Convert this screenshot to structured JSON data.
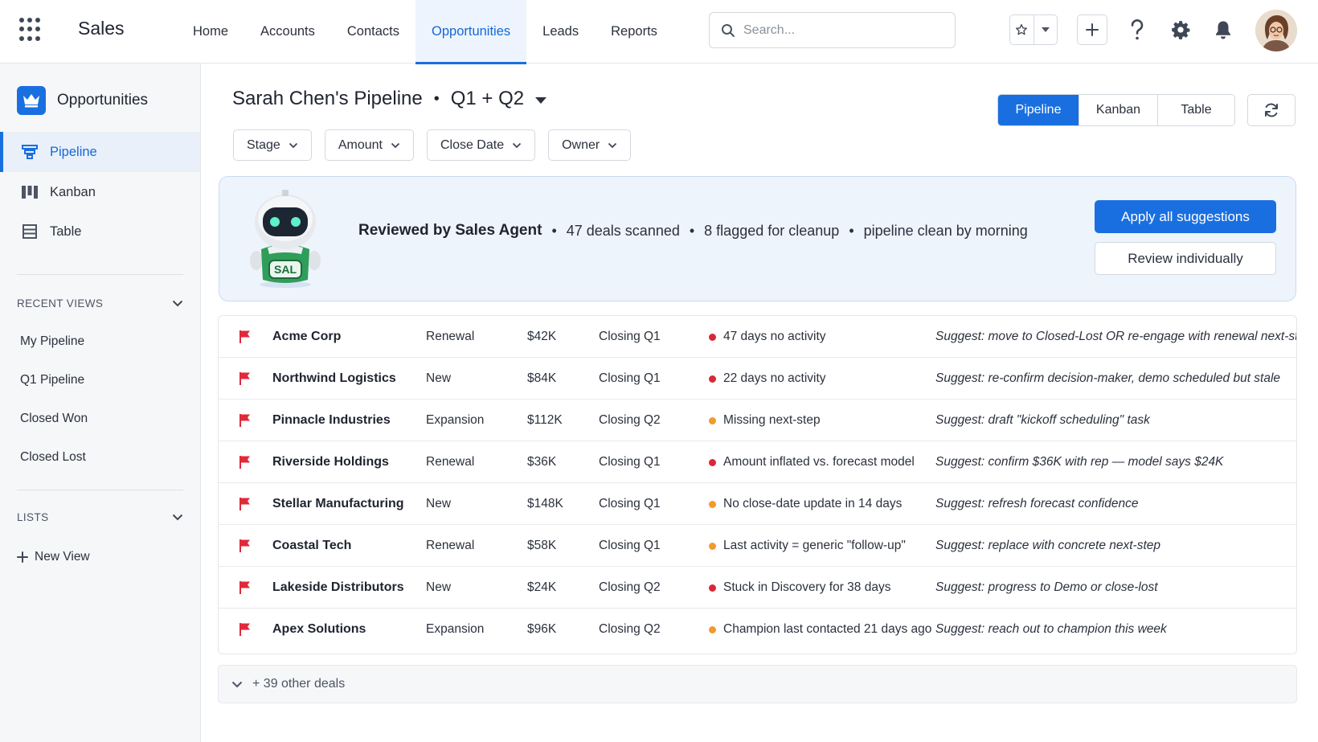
{
  "app": {
    "name": "Sales"
  },
  "nav": {
    "items": [
      "Home",
      "Accounts",
      "Contacts",
      "Opportunities",
      "Leads",
      "Reports"
    ],
    "active": "Opportunities"
  },
  "search": {
    "placeholder": "Search..."
  },
  "sidebar": {
    "title": "Opportunities",
    "views": [
      {
        "label": "Pipeline",
        "icon": "pipeline-icon",
        "active": true
      },
      {
        "label": "Kanban",
        "icon": "kanban-icon",
        "active": false
      },
      {
        "label": "Table",
        "icon": "table-icon",
        "active": false
      }
    ],
    "recent_views": {
      "heading": "RECENT VIEWS",
      "items": [
        "My Pipeline",
        "Q1 Pipeline",
        "Closed Won",
        "Closed Lost"
      ]
    },
    "lists": {
      "heading": "LISTS",
      "new_view": "New View"
    }
  },
  "page": {
    "title": "Sarah Chen's Pipeline",
    "period": "Q1 + Q2",
    "view_toggle": [
      "Pipeline",
      "Kanban",
      "Table"
    ],
    "active_view": "Pipeline",
    "filters": [
      "Stage",
      "Amount",
      "Close Date",
      "Owner"
    ]
  },
  "agent_banner": {
    "robot_badge": "SAL",
    "title": "Reviewed by Sales Agent",
    "scanned": "47 deals scanned",
    "flagged": "8 flagged for cleanup",
    "eta": "pipeline clean by morning",
    "apply_label": "Apply all suggestions",
    "review_label": "Review individually"
  },
  "deals": [
    {
      "name": "Acme Corp",
      "type": "Renewal",
      "amount": "$42K",
      "close": "Closing Q1",
      "severity": "red",
      "issue": "47 days no activity",
      "suggestion": "Suggest: move to Closed-Lost OR re-engage with renewal next-step"
    },
    {
      "name": "Northwind Logistics",
      "type": "New",
      "amount": "$84K",
      "close": "Closing Q1",
      "severity": "red",
      "issue": "22 days no activity",
      "suggestion": "Suggest: re-confirm decision-maker, demo scheduled but stale"
    },
    {
      "name": "Pinnacle Industries",
      "type": "Expansion",
      "amount": "$112K",
      "close": "Closing Q2",
      "severity": "orange",
      "issue": "Missing next-step",
      "suggestion": "Suggest: draft \"kickoff scheduling\" task"
    },
    {
      "name": "Riverside Holdings",
      "type": "Renewal",
      "amount": "$36K",
      "close": "Closing Q1",
      "severity": "red",
      "issue": "Amount inflated vs. forecast model",
      "suggestion": "Suggest: confirm $36K with rep — model says $24K"
    },
    {
      "name": "Stellar Manufacturing",
      "type": "New",
      "amount": "$148K",
      "close": "Closing Q1",
      "severity": "orange",
      "issue": "No close-date update in 14 days",
      "suggestion": "Suggest: refresh forecast confidence"
    },
    {
      "name": "Coastal Tech",
      "type": "Renewal",
      "amount": "$58K",
      "close": "Closing Q1",
      "severity": "orange",
      "issue": "Last activity = generic \"follow-up\"",
      "suggestion": "Suggest: replace with concrete next-step"
    },
    {
      "name": "Lakeside Distributors",
      "type": "New",
      "amount": "$24K",
      "close": "Closing Q2",
      "severity": "red",
      "issue": "Stuck in Discovery for 38 days",
      "suggestion": "Suggest: progress to Demo or close-lost"
    },
    {
      "name": "Apex Solutions",
      "type": "Expansion",
      "amount": "$96K",
      "close": "Closing Q2",
      "severity": "orange",
      "issue": "Champion last contacted 21 days ago",
      "suggestion": "Suggest: reach out to champion this week"
    }
  ],
  "more_deals": "+ 39 other deals",
  "colors": {
    "accent": "#1a6fe0",
    "flag": "#e0293a",
    "red": "#d8283a",
    "orange": "#f29a2e",
    "banner_bg": "#eef4fc"
  }
}
